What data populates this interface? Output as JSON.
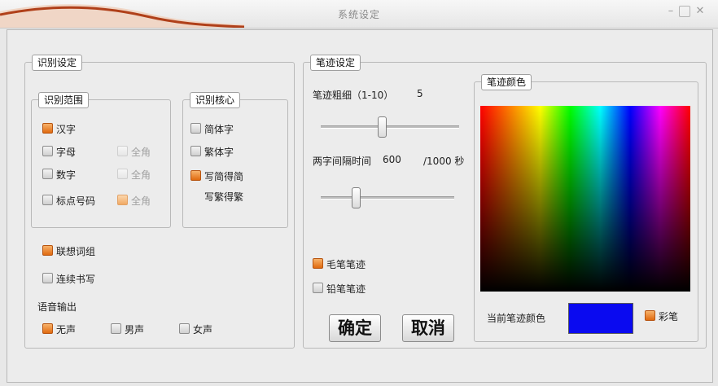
{
  "window": {
    "title": "系统设定",
    "colors": {
      "accent": "#e06a10",
      "current_pen": "#0a0af0",
      "title_swoosh": "#b0401a"
    }
  },
  "recognition": {
    "legend": "识别设定",
    "range": {
      "legend": "识别范围",
      "items": [
        {
          "label": "汉字",
          "checked": true
        },
        {
          "label": "字母",
          "checked": false
        },
        {
          "label": "数字",
          "checked": false
        },
        {
          "label": "标点号码",
          "checked": false
        }
      ],
      "fullwidth": [
        {
          "label": "全角",
          "checked": false
        },
        {
          "label": "全角",
          "checked": false
        },
        {
          "label": "全角",
          "checked": true
        }
      ]
    },
    "core": {
      "legend": "识别核心",
      "items": [
        {
          "label": "简体字",
          "checked": false
        },
        {
          "label": "繁体字",
          "checked": false
        },
        {
          "label": "写简得简",
          "checked": true
        }
      ],
      "extra": "写繁得繁"
    },
    "association": {
      "label": "联想词组",
      "checked": true
    },
    "continuous": {
      "label": "连续书写",
      "checked": false
    },
    "voice": {
      "label": "语音输出",
      "options": [
        {
          "label": "无声",
          "checked": true
        },
        {
          "label": "男声",
          "checked": false
        },
        {
          "label": "女声",
          "checked": false
        }
      ]
    }
  },
  "stroke": {
    "legend": "笔迹设定",
    "thickness": {
      "label": "笔迹粗细（1-10）",
      "value": "5",
      "fraction": 0.44
    },
    "interval": {
      "label": "两字间隔时间",
      "value": "600",
      "unit": "/1000 秒",
      "fraction": 0.26
    },
    "brush": {
      "label": "毛笔笔迹",
      "checked": true
    },
    "pencil": {
      "label": "铅笔笔迹",
      "checked": false
    },
    "ok": "确定",
    "cancel": "取消",
    "color": {
      "legend": "笔迹颜色",
      "current_label": "当前笔迹颜色",
      "rainbow": {
        "label": "彩笔",
        "checked": true
      }
    }
  }
}
